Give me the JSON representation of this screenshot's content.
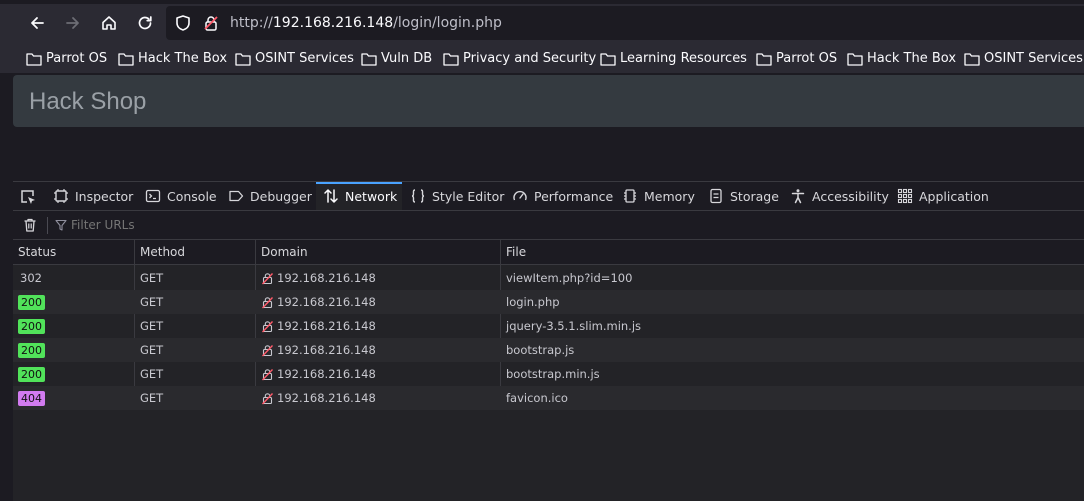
{
  "browser": {
    "url": {
      "prefix": "http://",
      "host": "192.168.216.148",
      "path": "/login/login.php"
    },
    "bookmarks": [
      "Parrot OS",
      "Hack The Box",
      "OSINT Services",
      "Vuln DB",
      "Privacy and Security",
      "Learning Resources",
      "Parrot OS",
      "Hack The Box",
      "OSINT Services"
    ]
  },
  "page": {
    "brand": "Hack Shop"
  },
  "devtools": {
    "tabs": [
      {
        "label": "Inspector",
        "icon": "inspector-icon"
      },
      {
        "label": "Console",
        "icon": "console-icon"
      },
      {
        "label": "Debugger",
        "icon": "debugger-icon"
      },
      {
        "label": "Network",
        "icon": "network-icon",
        "active": true
      },
      {
        "label": "Style Editor",
        "icon": "style-editor-icon"
      },
      {
        "label": "Performance",
        "icon": "performance-icon"
      },
      {
        "label": "Memory",
        "icon": "memory-icon"
      },
      {
        "label": "Storage",
        "icon": "storage-icon"
      },
      {
        "label": "Accessibility",
        "icon": "accessibility-icon"
      },
      {
        "label": "Application",
        "icon": "application-icon"
      }
    ],
    "filter_placeholder": "Filter URLs",
    "columns": [
      "Status",
      "Method",
      "Domain",
      "File"
    ],
    "requests": [
      {
        "status": "302",
        "method": "GET",
        "domain": "192.168.216.148",
        "file": "viewItem.php?id=100"
      },
      {
        "status": "200",
        "method": "GET",
        "domain": "192.168.216.148",
        "file": "login.php"
      },
      {
        "status": "200",
        "method": "GET",
        "domain": "192.168.216.148",
        "file": "jquery-3.5.1.slim.min.js"
      },
      {
        "status": "200",
        "method": "GET",
        "domain": "192.168.216.148",
        "file": "bootstrap.js"
      },
      {
        "status": "200",
        "method": "GET",
        "domain": "192.168.216.148",
        "file": "bootstrap.min.js"
      },
      {
        "status": "404",
        "method": "GET",
        "domain": "192.168.216.148",
        "file": "favicon.ico"
      }
    ],
    "status_colors": {
      "200": "#51e35a",
      "404": "#d27bf0",
      "302": "none"
    }
  }
}
